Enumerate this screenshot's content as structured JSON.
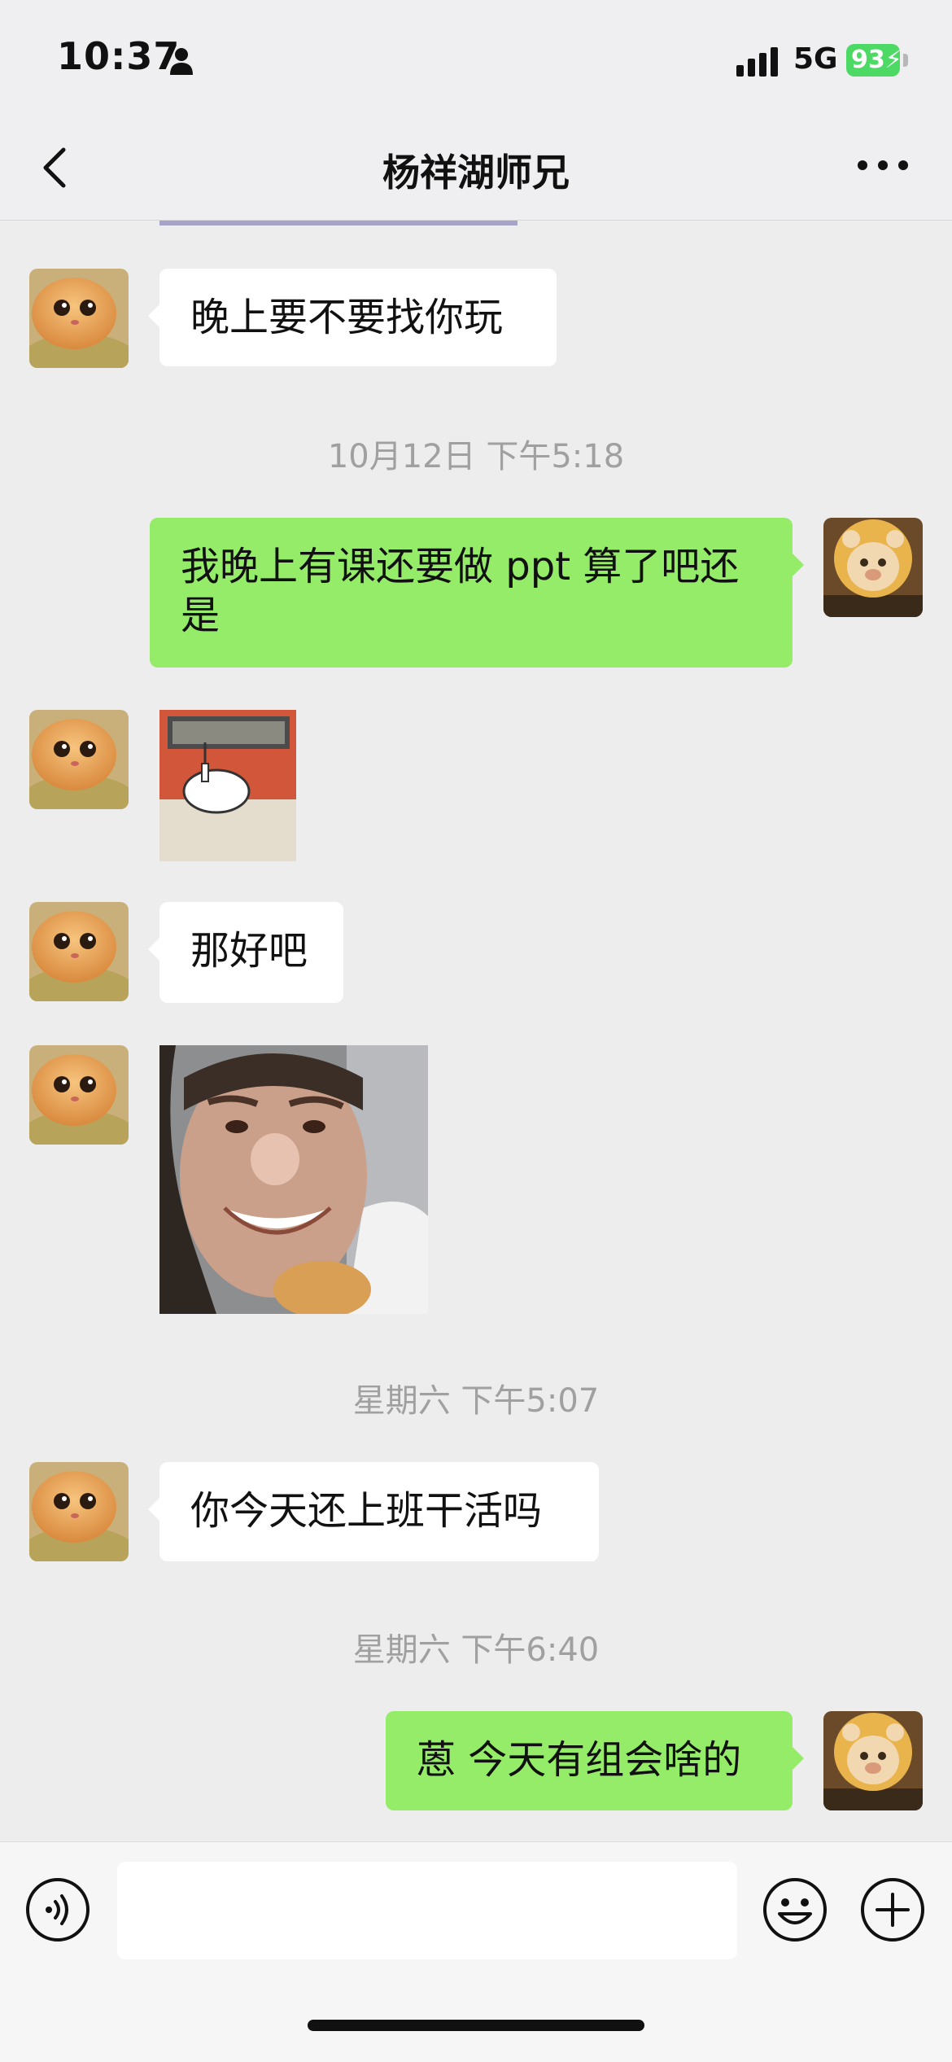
{
  "status_bar": {
    "time": "10:37",
    "network": "5G",
    "battery": "93"
  },
  "header": {
    "title": "杨祥湖师兄"
  },
  "messages": [
    {
      "type": "text",
      "side": "in",
      "text": "晚上要不要找你玩"
    },
    {
      "type": "timestamp",
      "text": "10月12日 下午5:18"
    },
    {
      "type": "text",
      "side": "out",
      "text": "我晚上有课还要做 ppt 算了吧还是"
    },
    {
      "type": "sticker",
      "side": "in"
    },
    {
      "type": "text",
      "side": "in",
      "text": "那好吧"
    },
    {
      "type": "image",
      "side": "in"
    },
    {
      "type": "timestamp",
      "text": "星期六 下午5:07"
    },
    {
      "type": "text",
      "side": "in",
      "text": "你今天还上班干活吗"
    },
    {
      "type": "timestamp",
      "text": "星期六 下午6:40"
    },
    {
      "type": "text",
      "side": "out",
      "text": "蒽 今天有组会啥的"
    }
  ],
  "input": {
    "value": ""
  }
}
